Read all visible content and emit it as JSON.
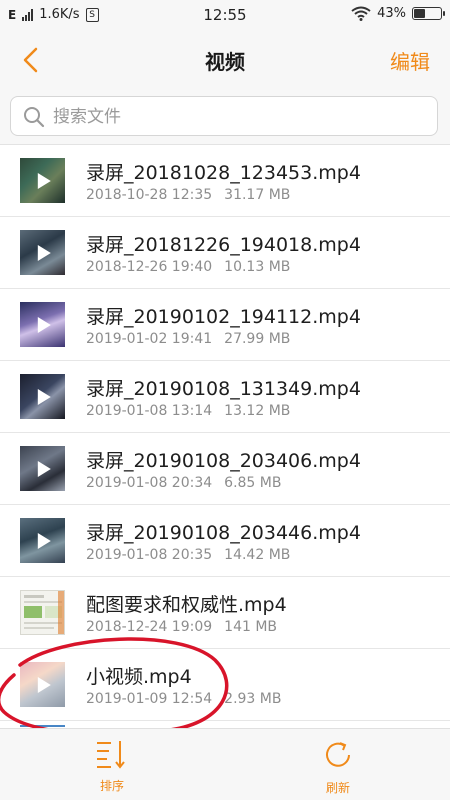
{
  "status_bar": {
    "network": "E",
    "speed": "1.6K/s",
    "sim_label": "S",
    "time": "12:55",
    "battery": "43%",
    "battery_level": 0.43
  },
  "nav": {
    "title": "视频",
    "edit_label": "编辑"
  },
  "search": {
    "placeholder": "搜索文件"
  },
  "files": [
    {
      "name": "录屏_20181028_123453.mp4",
      "date": "2018-10-28 12:35",
      "size": "31.17 MB"
    },
    {
      "name": "录屏_20181226_194018.mp4",
      "date": "2018-12-26 19:40",
      "size": "10.13 MB"
    },
    {
      "name": "录屏_20190102_194112.mp4",
      "date": "2019-01-02 19:41",
      "size": "27.99 MB"
    },
    {
      "name": "录屏_20190108_131349.mp4",
      "date": "2019-01-08 13:14",
      "size": "13.12 MB"
    },
    {
      "name": "录屏_20190108_203406.mp4",
      "date": "2019-01-08 20:34",
      "size": "6.85 MB"
    },
    {
      "name": "录屏_20190108_203446.mp4",
      "date": "2019-01-08 20:35",
      "size": "14.42 MB"
    },
    {
      "name": "配图要求和权威性.mp4",
      "date": "2018-12-24 19:09",
      "size": "141 MB"
    },
    {
      "name": "小视频.mp4",
      "date": "2019-01-09 12:54",
      "size": "2.93 MB"
    }
  ],
  "bottom_bar": {
    "sort_label": "排序",
    "refresh_label": "刷新"
  },
  "colors": {
    "accent": "#f08a1a",
    "annotation": "#d8142a"
  }
}
